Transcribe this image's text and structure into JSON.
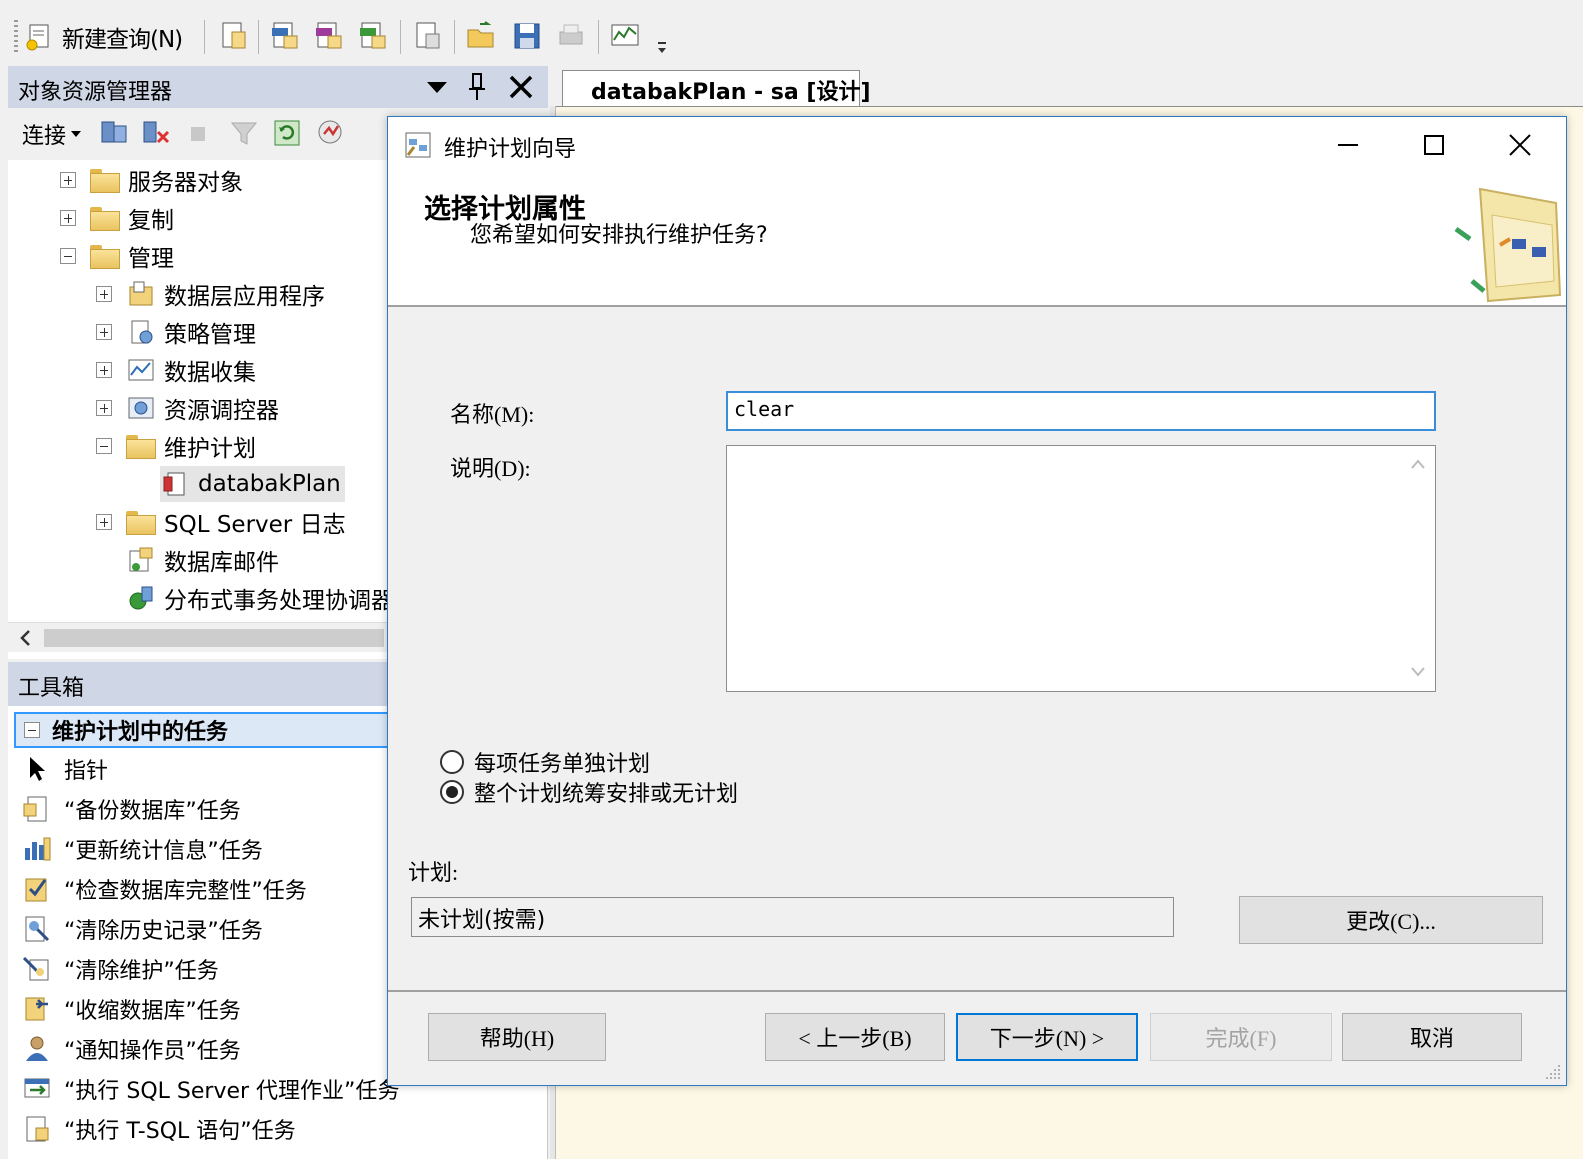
{
  "toolbar": {
    "new_query_label": "新建查询(N)"
  },
  "object_explorer": {
    "title": "对象资源管理器",
    "connect_label": "连接",
    "nodes": [
      {
        "label": "服务器对象",
        "expanded": false,
        "icon": "folder-icon"
      },
      {
        "label": "复制",
        "expanded": false,
        "icon": "folder-icon"
      },
      {
        "label": "管理",
        "expanded": true,
        "icon": "folder-icon"
      },
      {
        "label": "数据层应用程序",
        "expanded": false,
        "icon": "data-tier-app-icon"
      },
      {
        "label": "策略管理",
        "expanded": false,
        "icon": "policy-icon"
      },
      {
        "label": "数据收集",
        "expanded": false,
        "icon": "data-collection-icon"
      },
      {
        "label": "资源调控器",
        "expanded": false,
        "icon": "resource-governor-icon"
      },
      {
        "label": "维护计划",
        "expanded": true,
        "icon": "folder-icon"
      },
      {
        "label": "databakPlan",
        "icon": "maintenance-plan-icon",
        "selected": true
      },
      {
        "label": "SQL Server 日志",
        "expanded": false,
        "icon": "folder-icon"
      },
      {
        "label": "数据库邮件",
        "icon": "database-mail-icon"
      },
      {
        "label": "分布式事务处理协调器",
        "icon": "dtc-icon"
      }
    ]
  },
  "toolbox": {
    "title": "工具箱",
    "group_label": "维护计划中的任务",
    "items": [
      {
        "label": "指针",
        "icon": "pointer-icon"
      },
      {
        "label": "“备份数据库”任务",
        "icon": "backup-icon"
      },
      {
        "label": "“更新统计信息”任务",
        "icon": "statistics-icon"
      },
      {
        "label": "“检查数据库完整性”任务",
        "icon": "integrity-icon"
      },
      {
        "label": "“清除历史记录”任务",
        "icon": "history-cleanup-icon"
      },
      {
        "label": "“清除维护”任务",
        "icon": "maintenance-cleanup-icon"
      },
      {
        "label": "“收缩数据库”任务",
        "icon": "shrink-icon"
      },
      {
        "label": "“通知操作员”任务",
        "icon": "notify-operator-icon"
      },
      {
        "label": "“执行 SQL Server 代理作业”任务",
        "icon": "agent-job-icon"
      },
      {
        "label": "“执行 T-SQL 语句”任务",
        "icon": "tsql-icon"
      }
    ]
  },
  "document_tab": {
    "label": "databakPlan - sa [设计]"
  },
  "dialog": {
    "title": "维护计划向导",
    "heading": "选择计划属性",
    "subheading": "您希望如何安排执行维护任务?",
    "name_label": "名称(M):",
    "name_value": "clear",
    "description_label": "说明(D):",
    "description_value": "",
    "radio_separate": "每项任务单独计划",
    "radio_single": "整个计划统筹安排或无计划",
    "radio_selected": "single",
    "schedule_label": "计划:",
    "schedule_value": "未计划(按需)",
    "change_button": "更改(C)...",
    "help_button": "帮助(H)",
    "back_button": "< 上一步(B)",
    "next_button": "下一步(N) >",
    "finish_button": "完成(F)",
    "cancel_button": "取消"
  }
}
